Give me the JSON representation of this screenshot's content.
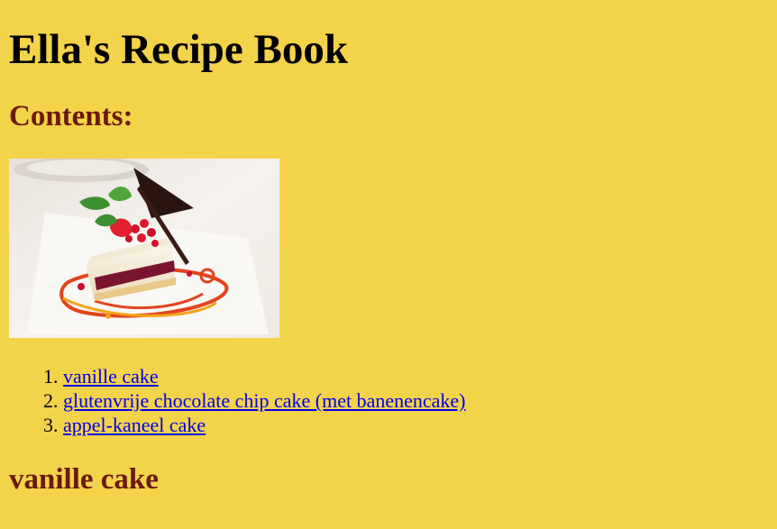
{
  "header": {
    "title": "Ella's Recipe Book"
  },
  "contents": {
    "heading": "Contents:",
    "image": "cake-slice-photo",
    "links": [
      {
        "label": "vanille cake"
      },
      {
        "label": "glutenvrije chocolate chip cake (met banenencake)"
      },
      {
        "label": "appel-kaneel cake"
      }
    ]
  },
  "sections": [
    {
      "heading": "vanille cake"
    }
  ],
  "colors": {
    "background": "#f3d34a",
    "heading": "#6b1a0c",
    "link": "#0000ee"
  }
}
